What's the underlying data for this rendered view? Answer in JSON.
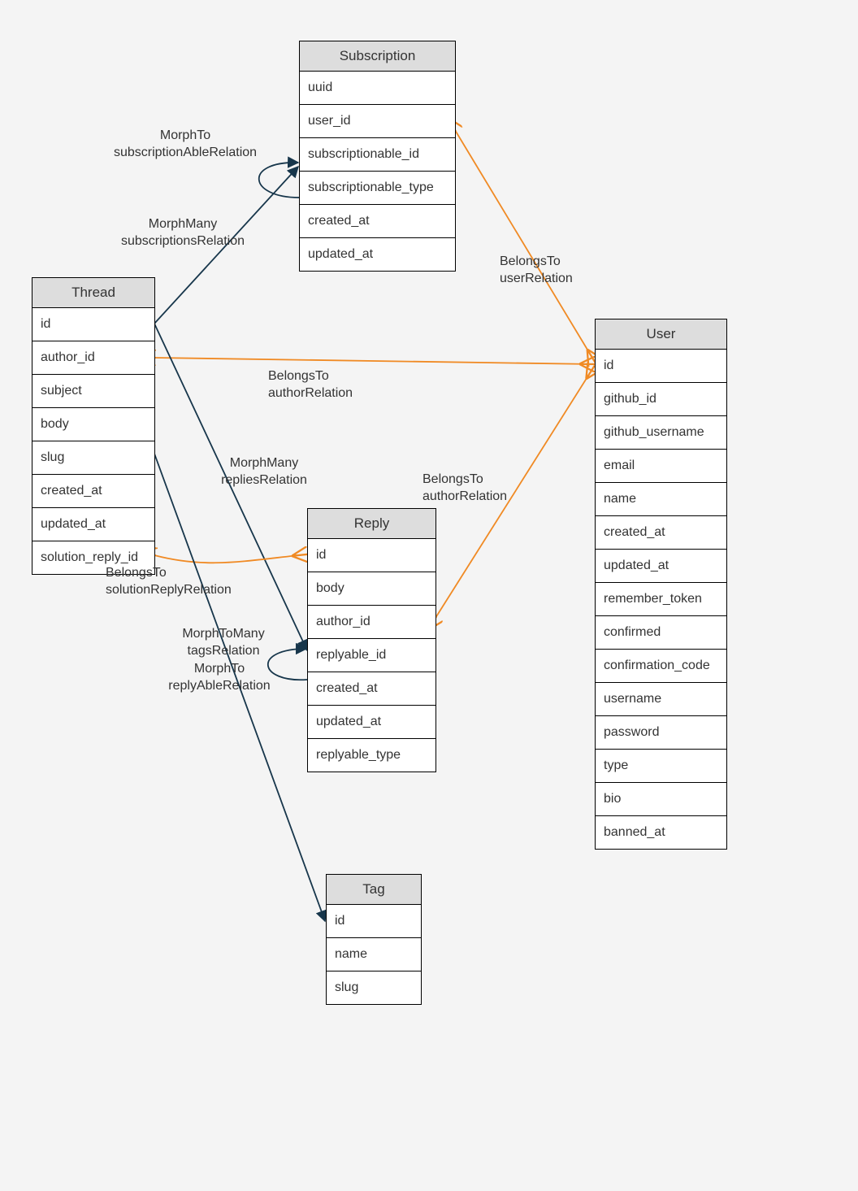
{
  "subscription": {
    "title": "Subscription",
    "fields": [
      "uuid",
      "user_id",
      "subscriptionable_id",
      "subscriptionable_type",
      "created_at",
      "updated_at"
    ]
  },
  "thread": {
    "title": "Thread",
    "fields": [
      "id",
      "author_id",
      "subject",
      "body",
      "slug",
      "created_at",
      "updated_at",
      "solution_reply_id"
    ]
  },
  "reply": {
    "title": "Reply",
    "fields": [
      "id",
      "body",
      "author_id",
      "replyable_id",
      "created_at",
      "updated_at",
      "replyable_type"
    ]
  },
  "user": {
    "title": "User",
    "fields": [
      "id",
      "github_id",
      "github_username",
      "email",
      "name",
      "created_at",
      "updated_at",
      "remember_token",
      "confirmed",
      "confirmation_code",
      "username",
      "password",
      "type",
      "bio",
      "banned_at"
    ]
  },
  "tag": {
    "title": "Tag",
    "fields": [
      "id",
      "name",
      "slug"
    ]
  },
  "labels": {
    "l1": "MorphTo\nsubscriptionAbleRelation",
    "l2": "MorphMany\nsubscriptionsRelation",
    "l3": "BelongsTo\nuserRelation",
    "l4": "BelongsTo\nauthorRelation",
    "l5": "MorphMany\nrepliesRelation",
    "l6": "BelongsTo\nauthorRelation",
    "l7": "BelongsTo\nsolutionReplyRelation",
    "l8": "MorphToMany\ntagsRelation",
    "l9": "MorphTo\nreplyAbleRelation"
  },
  "chart_data": {
    "type": "erd",
    "entities": {
      "Subscription": [
        "uuid",
        "user_id",
        "subscriptionable_id",
        "subscriptionable_type",
        "created_at",
        "updated_at"
      ],
      "Thread": [
        "id",
        "author_id",
        "subject",
        "body",
        "slug",
        "created_at",
        "updated_at",
        "solution_reply_id"
      ],
      "Reply": [
        "id",
        "body",
        "author_id",
        "replyable_id",
        "created_at",
        "updated_at",
        "replyable_type"
      ],
      "Tag": [
        "id",
        "name",
        "slug"
      ],
      "User": [
        "id",
        "github_id",
        "github_username",
        "email",
        "name",
        "created_at",
        "updated_at",
        "remember_token",
        "confirmed",
        "confirmation_code",
        "username",
        "password",
        "type",
        "bio",
        "banned_at"
      ]
    },
    "relations": [
      {
        "from": "Subscription.subscriptionable_type",
        "to": "Subscription.subscriptionable_id",
        "label": "MorphTo subscriptionAbleRelation",
        "color": "navy"
      },
      {
        "from": "Thread.id",
        "to": "Subscription.subscriptionable_id",
        "label": "MorphMany subscriptionsRelation",
        "color": "navy"
      },
      {
        "from": "Subscription.user_id",
        "to": "User.id",
        "label": "BelongsTo userRelation",
        "color": "orange"
      },
      {
        "from": "Thread.author_id",
        "to": "User.id",
        "label": "BelongsTo authorRelation",
        "color": "orange"
      },
      {
        "from": "Thread.id",
        "to": "Reply.replyable_id",
        "label": "MorphMany repliesRelation",
        "color": "navy"
      },
      {
        "from": "Reply.author_id",
        "to": "User.id",
        "label": "BelongsTo authorRelation",
        "color": "orange"
      },
      {
        "from": "Thread.solution_reply_id",
        "to": "Reply.id",
        "label": "BelongsTo solutionReplyRelation",
        "color": "orange"
      },
      {
        "from": "Thread.slug",
        "to": "Tag.id",
        "label": "MorphToMany tagsRelation",
        "color": "navy"
      },
      {
        "from": "Reply.replyable_type",
        "to": "Reply.replyable_id",
        "label": "MorphTo replyAbleRelation",
        "color": "navy"
      }
    ]
  }
}
